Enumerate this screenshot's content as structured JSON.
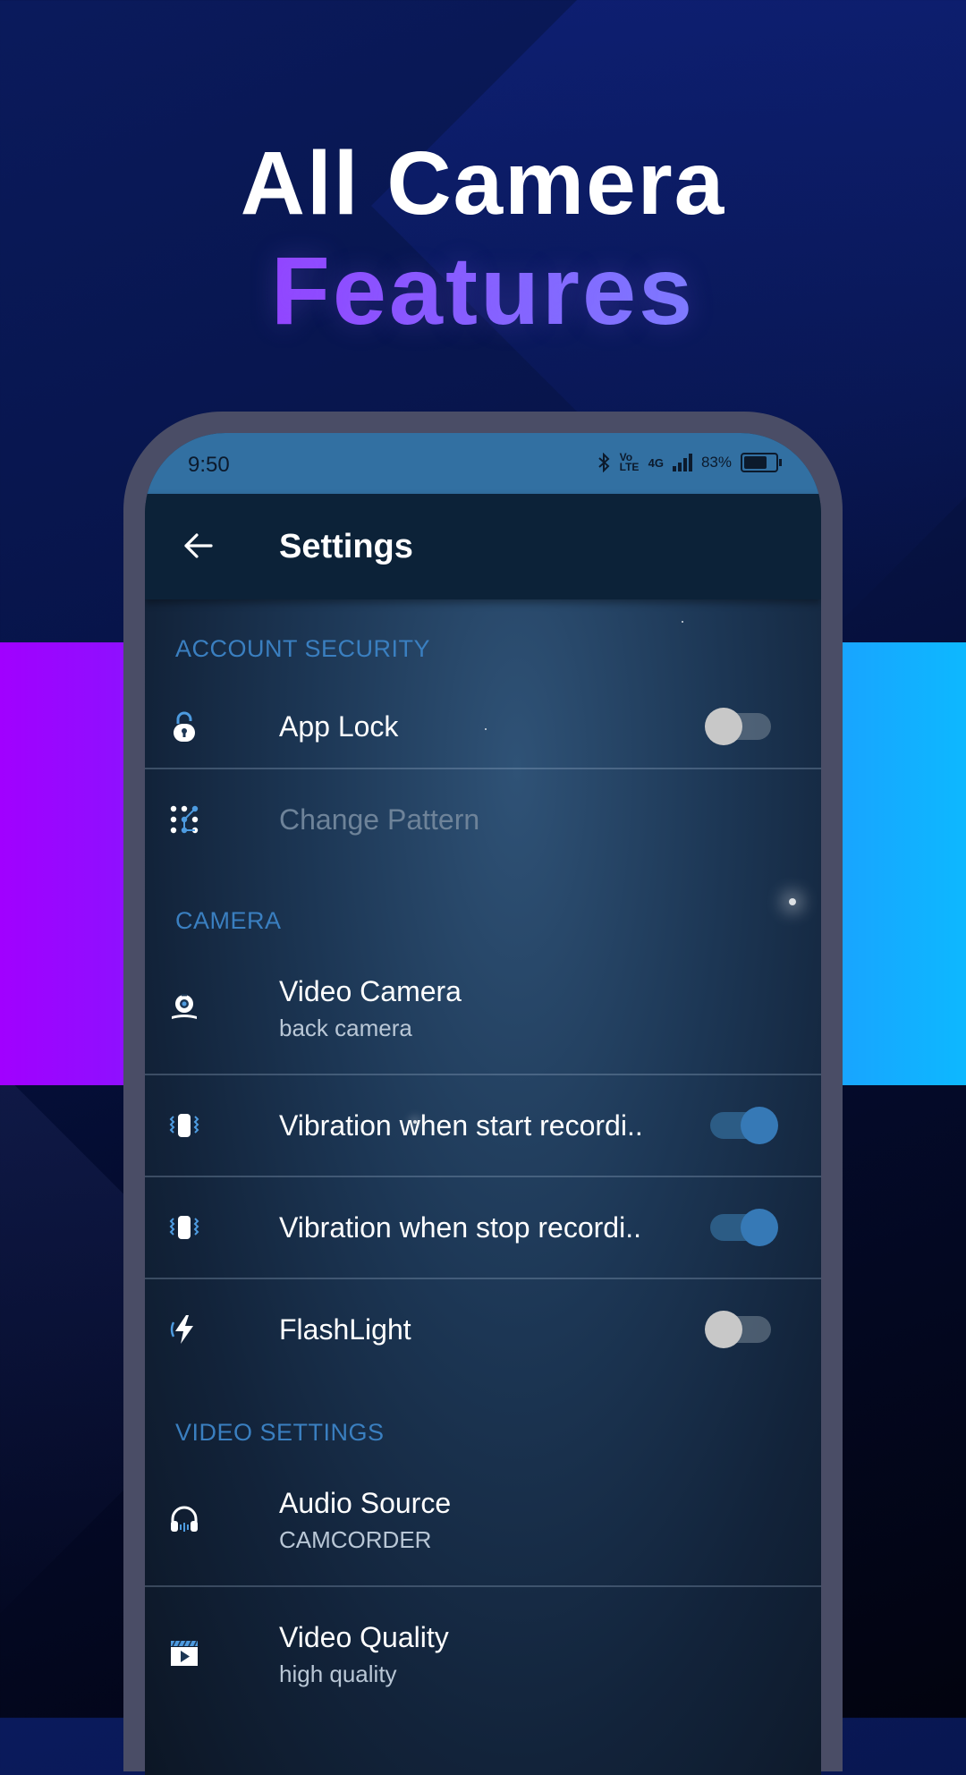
{
  "promo": {
    "headline_line1": "All Camera",
    "headline_line2": "Features"
  },
  "status_bar": {
    "time": "9:50",
    "battery": "83%",
    "battery_level": 0.83,
    "network": "4G",
    "volte": "Vo LTE",
    "icons": [
      "bluetooth-icon",
      "signal-icon",
      "battery-icon"
    ]
  },
  "toolbar": {
    "title": "Settings",
    "back_icon": "arrow-left-icon"
  },
  "sections": {
    "account_security": "ACCOUNT SECURITY",
    "camera": "CAMERA",
    "video_settings": "VIDEO SETTINGS"
  },
  "items": {
    "app_lock": {
      "title": "App Lock",
      "icon": "lock-icon",
      "toggle": false
    },
    "change_pattern": {
      "title": "Change Pattern",
      "icon": "pattern-icon",
      "enabled": false
    },
    "video_camera": {
      "title": "Video Camera",
      "subtitle": "back camera",
      "icon": "webcam-icon"
    },
    "vibration_start": {
      "title": "Vibration when start recordi..",
      "icon": "vibrate-icon",
      "toggle": true
    },
    "vibration_stop": {
      "title": "Vibration when stop recordi..",
      "icon": "vibrate-icon",
      "toggle": true
    },
    "flashlight": {
      "title": "FlashLight",
      "icon": "flash-icon",
      "toggle": false
    },
    "audio_source": {
      "title": "Audio Source",
      "subtitle": "CAMCORDER",
      "icon": "headphones-icon"
    },
    "video_quality": {
      "title": "Video Quality",
      "subtitle": "high quality",
      "icon": "clapperboard-icon"
    }
  },
  "colors": {
    "accent": "#3679b6",
    "section_header": "#3a7fc0",
    "status_bar": "#3270a2",
    "toolbar": "#0c2238",
    "band_left": "#a100ff",
    "band_right": "#0db8ff"
  }
}
